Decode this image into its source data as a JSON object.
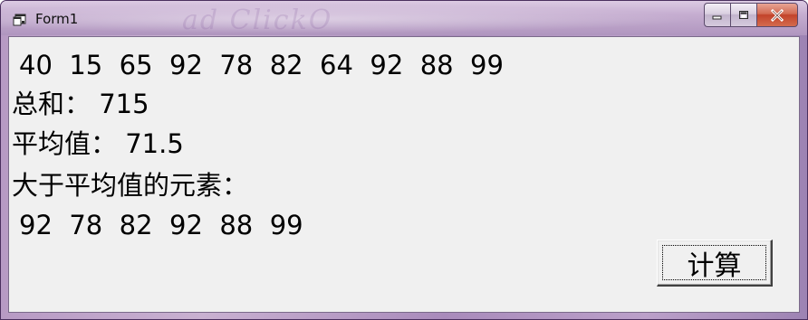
{
  "window": {
    "title": "Form1",
    "icon": "form-app-icon",
    "caption_buttons": [
      "minimize-icon",
      "maximize-icon",
      "close-icon"
    ]
  },
  "output": {
    "numbers_line": "40  15  65  92  78  82  64  92  88  99",
    "sum_line": "总和： 715",
    "average_line": "平均值： 71.5",
    "above_avg_heading": "大于平均值的元素：",
    "above_avg_line": "92  78  82  92  88  99"
  },
  "buttons": {
    "compute_label": "计算"
  }
}
